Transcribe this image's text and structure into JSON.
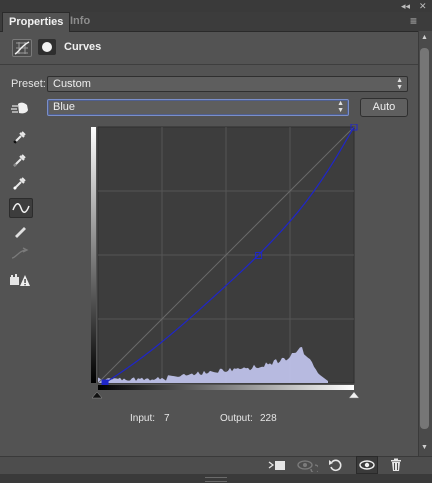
{
  "window": {
    "collapse_glyph": "◂◂",
    "close_glyph": "✕",
    "menu_glyph": "≡"
  },
  "tabs": [
    {
      "label": "Properties",
      "active": true
    },
    {
      "label": "Info",
      "active": false
    }
  ],
  "header": {
    "title": "Curves",
    "icons": [
      "curves-adjustment-icon",
      "layer-mask-icon"
    ]
  },
  "preset": {
    "label": "Preset:",
    "value": "Custom"
  },
  "channel": {
    "value": "Blue",
    "auto_label": "Auto"
  },
  "tools": [
    "on-image-adjust-hand-icon",
    "black-point-eyedropper-icon",
    "gray-point-eyedropper-icon",
    "white-point-eyedropper-icon",
    "curve-point-tool-icon",
    "pencil-draw-icon",
    "smooth-curve-icon",
    "clipping-warning-icon"
  ],
  "chart_data": {
    "type": "line",
    "xlim": [
      0,
      255
    ],
    "ylim": [
      0,
      255
    ],
    "grid": "4x4",
    "channel_color": "#1f26c8",
    "points": [
      [
        7,
        0
      ],
      [
        160,
        127
      ],
      [
        255,
        255
      ]
    ],
    "curve": [
      [
        7,
        0
      ],
      [
        40,
        22
      ],
      [
        80,
        54
      ],
      [
        120,
        90
      ],
      [
        160,
        127
      ],
      [
        200,
        170
      ],
      [
        230,
        212
      ],
      [
        255,
        255
      ]
    ],
    "histogram_shape": "low in shadows, rising through midtones, peak near 210, clipped above 230"
  },
  "readouts": {
    "input_label": "Input:",
    "input_value": "7",
    "output_label": "Output:",
    "output_value": "228"
  },
  "bottom_icons": [
    "clip-to-layer-icon",
    "view-previous-state-icon",
    "reset-icon",
    "visibility-eye-icon",
    "trash-icon"
  ],
  "colors": {
    "panel": "#535353",
    "curve": "#1f26c8",
    "histogram": "#c4c8f2"
  }
}
